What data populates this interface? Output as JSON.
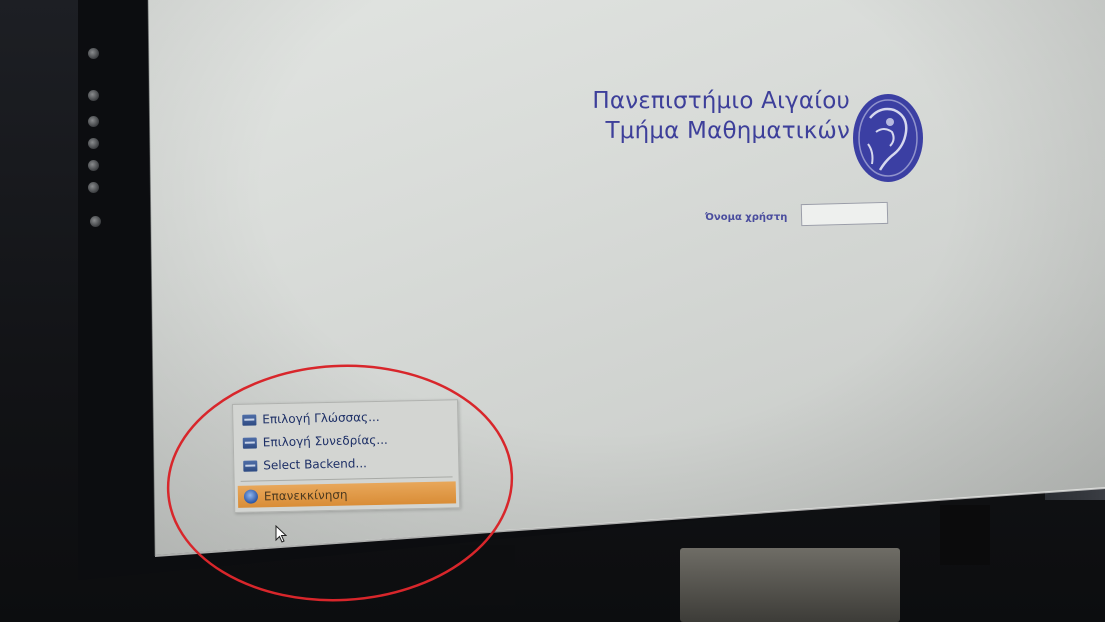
{
  "header": {
    "line1": "Πανεπιστήμιο Αιγαίου",
    "line2": "Τμήμα Μαθηματικών",
    "logo_icon": "university-seal-icon"
  },
  "login": {
    "username_label": "Όνομα χρήστη",
    "username_value": ""
  },
  "menu": {
    "items": [
      {
        "label": "Επιλογή Γλώσσας...",
        "icon": "language-icon"
      },
      {
        "label": "Επιλογή Συνεδρίας...",
        "icon": "session-icon"
      },
      {
        "label": "Select Backend...",
        "icon": "backend-icon"
      }
    ],
    "restart": {
      "label": "Επανεκκίνηση",
      "icon": "restart-icon"
    }
  },
  "colors": {
    "title": "#3d3f9a",
    "menu_highlight": "#d98d37",
    "annotation": "#d8262b"
  }
}
